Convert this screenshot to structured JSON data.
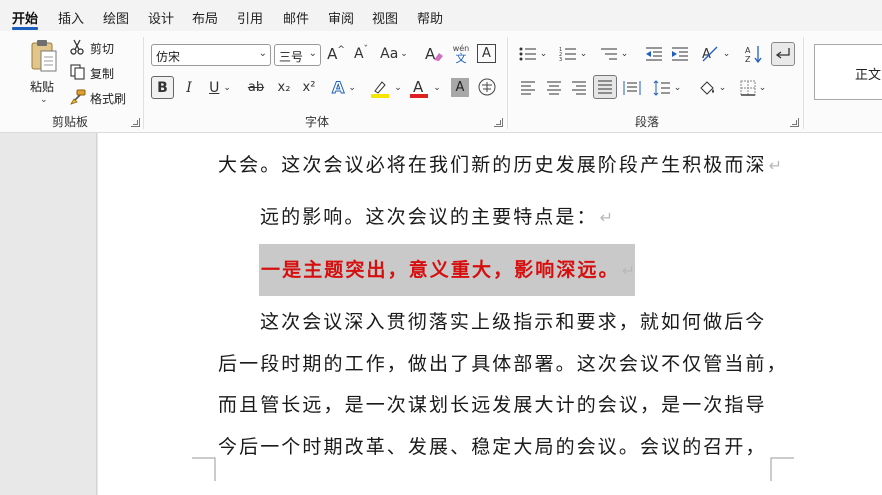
{
  "tabs": [
    "开始",
    "插入",
    "绘图",
    "设计",
    "布局",
    "引用",
    "邮件",
    "审阅",
    "视图",
    "帮助"
  ],
  "clipboard": {
    "paste_label": "粘贴",
    "cut_label": "剪切",
    "copy_label": "复制",
    "format_painter_label": "格式刷",
    "group_label": "剪贴板"
  },
  "font": {
    "font_name": "仿宋",
    "font_size": "三号",
    "grow_label": "A^",
    "shrink_label": "Aˇ",
    "case_label": "Aa",
    "phonetic_top": "wén",
    "phonetic_bottom": "文",
    "border_char_label": "A",
    "bold_label": "B",
    "italic_label": "I",
    "underline_label": "U",
    "strike_label": "ab",
    "subscript_label": "x₂",
    "superscript_label": "x²",
    "effects_label": "A",
    "highlight_label": "ab",
    "font_color_label": "A",
    "shading_label": "A",
    "enclose_label": "字",
    "group_label": "字体",
    "highlight_color": "#f5e500",
    "font_color": "#e02020"
  },
  "paragraph": {
    "group_label": "段落",
    "sort_label": "A↓Z"
  },
  "styles": {
    "normal_label": "正文"
  },
  "document": {
    "line1": "大会。这次会议必将在我们新的历史发展阶段产生积极而深",
    "line2": "远的影响。这次会议的主要特点是：",
    "line3": "一是主题突出，意义重大，影响深远。",
    "line4": "这次会议深入贯彻落实上级指示和要求，就如何做后今",
    "line5": "后一段时期的工作，做出了具体部署。这次会议不仅管当前，",
    "line6": "而且管长远，是一次谋划长远发展大计的会议，是一次指导",
    "line7": "今后一个时期改革、发展、稳定大局的会议。会议的召开，",
    "para_mark": "↵",
    "highlight_text_color": "#d80e0e"
  }
}
